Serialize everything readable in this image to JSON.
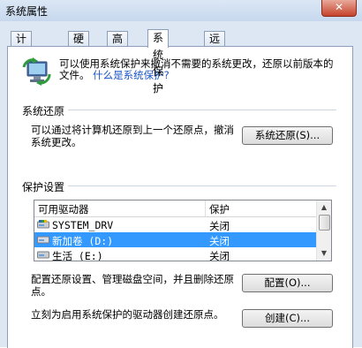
{
  "window": {
    "title": "系统属性",
    "close_label": "✕"
  },
  "tabs": [
    {
      "label": "计算机名"
    },
    {
      "label": "硬件"
    },
    {
      "label": "高级"
    },
    {
      "label": "系统保护"
    },
    {
      "label": "远程"
    }
  ],
  "intro": {
    "text": "可以使用系统保护来撤消不需要的系统更改，还原以前版本的文件。",
    "link": "什么是系统保护?"
  },
  "restore": {
    "group_title": "系统还原",
    "description": "可以通过将计算机还原到上一个还原点，撤消系统更改。",
    "button": "系统还原(S)..."
  },
  "protection": {
    "group_title": "保护设置",
    "columns": [
      "可用驱动器",
      "保护"
    ],
    "rows": [
      {
        "drive": "SYSTEM_DRV",
        "status": "关闭"
      },
      {
        "drive": "新加卷 (D:)",
        "status": "关闭"
      },
      {
        "drive": "生活 (E:)",
        "status": "关闭"
      }
    ],
    "configure_text": "配置还原设置、管理磁盘空间，并且删除还原点。",
    "configure_button": "配置(O)...",
    "create_text": "立刻为启用系统保护的驱动器创建还原点。",
    "create_button": "创建(C)..."
  },
  "colors": {
    "selection": "#3399ff",
    "link": "#1a56c8"
  }
}
